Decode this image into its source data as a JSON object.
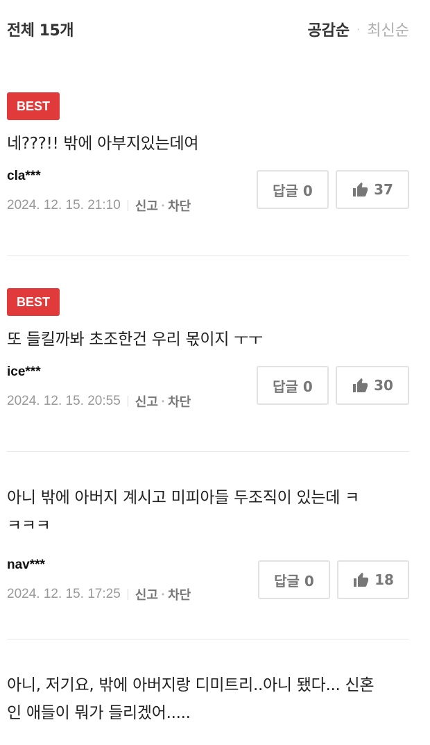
{
  "header": {
    "total": "전체 15개",
    "sort_active": "공감순",
    "sort_separator": "·",
    "sort_inactive": "최신순"
  },
  "comments": [
    {
      "badge": "BEST",
      "text": "네???!! 밖에 아부지있는데여",
      "author": "cla***",
      "date": "2024. 12. 15. 21:10",
      "report": "신고",
      "block": "차단",
      "reply_label": "답글 0",
      "likes": "37"
    },
    {
      "badge": "BEST",
      "text": "또 들킬까봐 초조한건 우리 몫이지 ㅜㅜ",
      "author": "ice***",
      "date": "2024. 12. 15. 20:55",
      "report": "신고",
      "block": "차단",
      "reply_label": "답글 0",
      "likes": "30"
    },
    {
      "text_line1": "아니 밖에 아버지 계시고 미피아들 두조직이 있는데 ㅋ",
      "text_line2": "ㅋㅋㅋ",
      "author": "nav***",
      "date": "2024. 12. 15. 17:25",
      "report": "신고",
      "block": "차단",
      "reply_label": "답글 0",
      "likes": "18"
    },
    {
      "text_line1": "아니, 저기요, 밖에 아버지랑 디미트리..아니 됐다... 신혼",
      "text_line2": "인 애들이 뭐가 들리겠어....."
    }
  ],
  "icons": {
    "like": "thumbs-up-icon"
  },
  "colors": {
    "best_badge": "#e03a3a",
    "border": "#e2e2e2"
  }
}
